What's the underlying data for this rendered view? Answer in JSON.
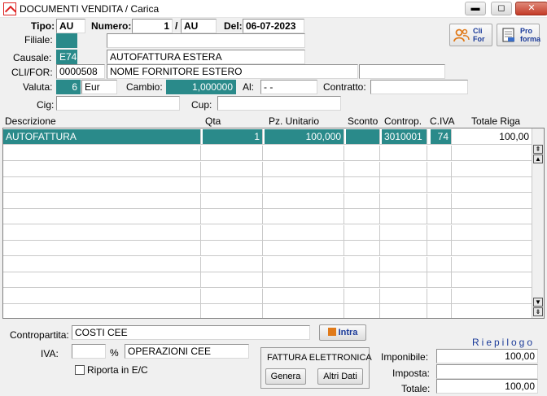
{
  "window": {
    "title": "DOCUMENTI VENDITA / Carica",
    "minimize": "▬",
    "maximize": "◻",
    "close": "✕"
  },
  "header": {
    "tipo_label": "Tipo:",
    "tipo_value": "AU",
    "numero_label": "Numero:",
    "numero_value": "1",
    "numero_sep": "/",
    "numero_suffix": "AU",
    "del_label": "Del:",
    "del_value": "06-07-2023",
    "filiale_label": "Filiale:",
    "filiale_code": "",
    "filiale_desc": "",
    "causale_label": "Causale:",
    "causale_code": "E74",
    "causale_desc": "AUTOFATTURA ESTERA",
    "clifor_label": "CLI/FOR:",
    "clifor_code": "0000508",
    "clifor_desc": "NOME FORNITORE ESTERO",
    "clifor_extra": "",
    "valuta_label": "Valuta:",
    "valuta_code": "6",
    "valuta_name": "Eur",
    "cambio_label": "Cambio:",
    "cambio_value": "1,000000",
    "al_label": "Al:",
    "al_value": "- -",
    "contratto_label": "Contratto:",
    "contratto_value": "",
    "cig_label": "Cig:",
    "cig_value": "",
    "cup_label": "Cup:",
    "cup_value": ""
  },
  "toolbar": {
    "clifor_button": [
      "Cli",
      "For"
    ],
    "proforma_button": [
      "Pro",
      "forma"
    ]
  },
  "grid": {
    "columns": [
      "Descrizione",
      "Qta",
      "Pz. Unitario",
      "Sconto",
      "Controp.",
      "C.IVA",
      "Totale Riga"
    ],
    "rows": [
      [
        "AUTOFATTURA",
        "1",
        "100,000",
        "",
        "3010001",
        "74",
        "100,00"
      ]
    ],
    "empty_rows": 11
  },
  "footer": {
    "contropartita_label": "Contropartita:",
    "contropartita_value": "COSTI CEE",
    "intra_button": "Intra",
    "iva_label": "IVA:",
    "iva_value": "",
    "percent": "%",
    "iva_desc": "OPERAZIONI CEE",
    "riporta_label": "Riporta in E/C",
    "fattura_title": "FATTURA ELETTRONICA",
    "genera_button": "Genera",
    "altri_dati_button": "Altri Dati",
    "riepilogo_title": "Riepilogo",
    "imponibile_label": "Imponibile:",
    "imponibile_value": "100,00",
    "imposta_label": "Imposta:",
    "imposta_value": "",
    "totale_label": "Totale:",
    "totale_value": "100,00"
  },
  "colors": {
    "accent_teal": "#2a8a8a",
    "window_bg": "#f0f0f0"
  }
}
